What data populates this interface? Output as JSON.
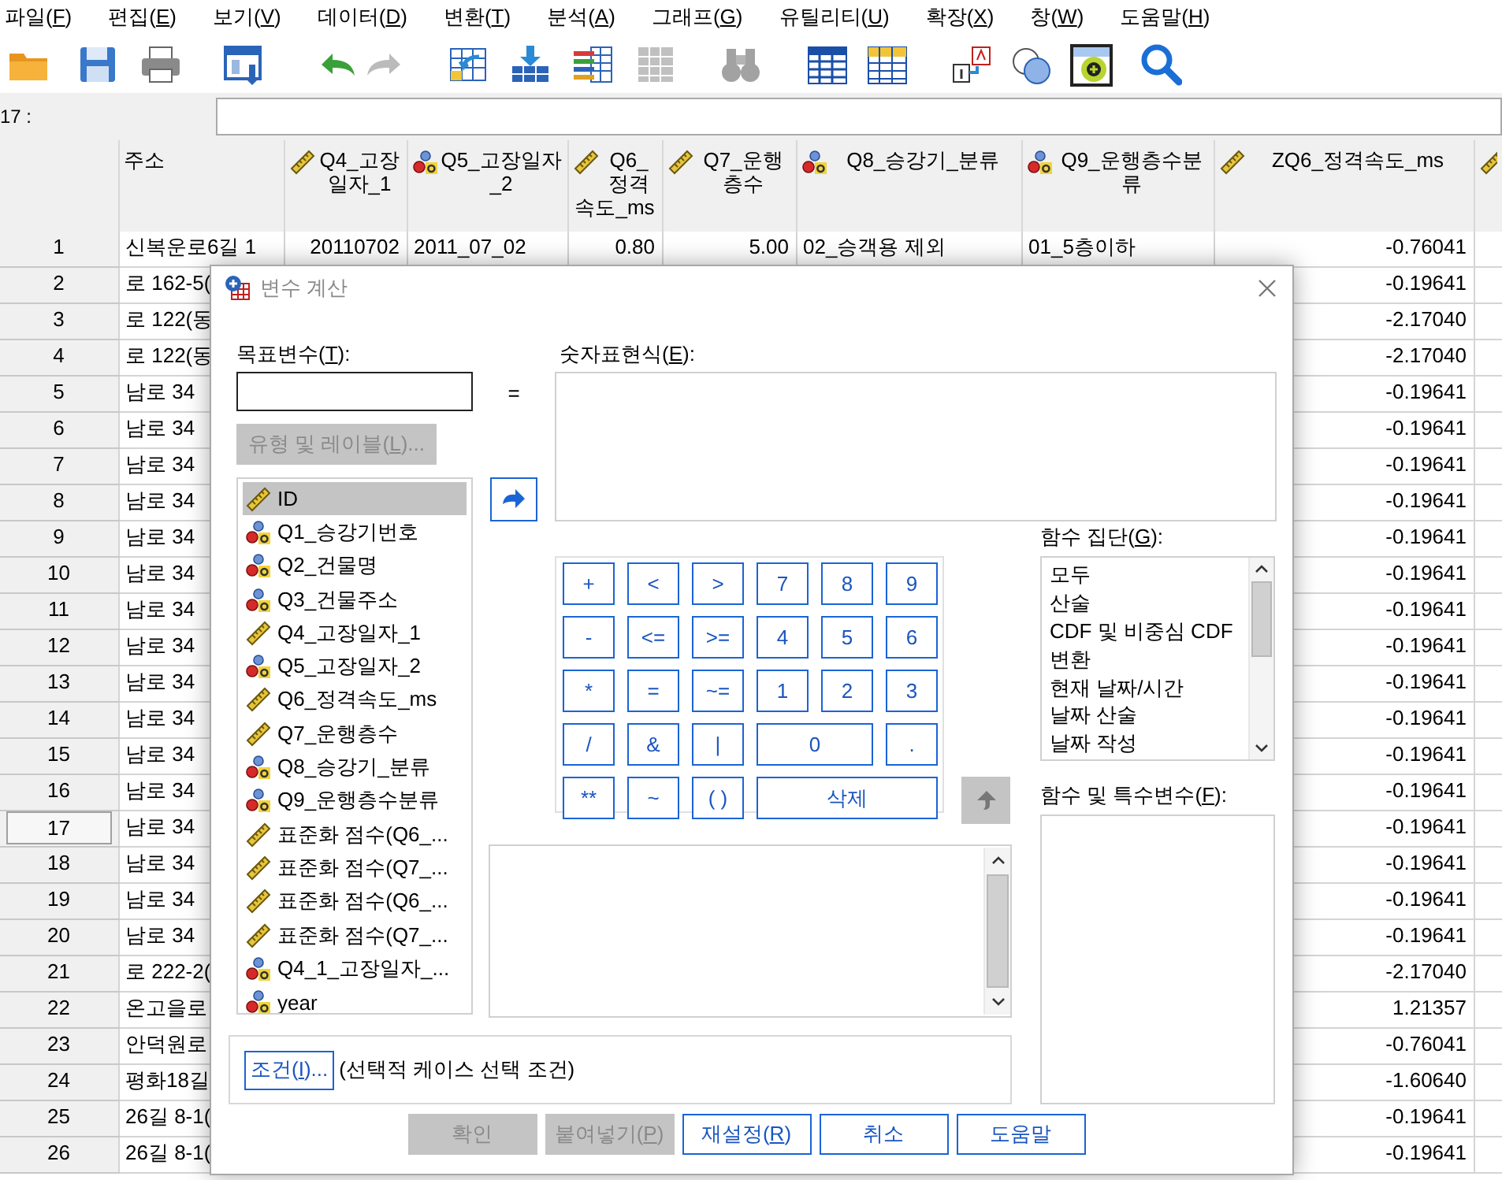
{
  "menu": [
    "파일(F)",
    "편집(E)",
    "보기(V)",
    "데이터(D)",
    "변환(T)",
    "분석(A)",
    "그래프(G)",
    "유틸리티(U)",
    "확장(X)",
    "창(W)",
    "도움말(H)"
  ],
  "toolbar": [
    {
      "disabled": false
    },
    {
      "disabled": false
    },
    {
      "disabled": false
    },
    {
      "disabled": false
    },
    {
      "disabled": false
    },
    {
      "disabled": true
    },
    {
      "disabled": false
    },
    {
      "disabled": false
    },
    {
      "disabled": false
    },
    {
      "disabled": true
    },
    {
      "disabled": true
    },
    {
      "disabled": false
    },
    {
      "disabled": false
    },
    {
      "disabled": false
    },
    {
      "disabled": false
    },
    {
      "disabled": false
    },
    {
      "disabled": false
    }
  ],
  "cell_ref": {
    "label": "17 :"
  },
  "grid": {
    "columns": [
      {
        "label": "주소"
      },
      {
        "label": "Q4_고장일자_1",
        "kind": "scale"
      },
      {
        "label": "Q5_고장일자_2",
        "kind": "nominal"
      },
      {
        "label": "Q6_정격속도_ms",
        "kind": "scale"
      },
      {
        "label": "Q7_운행층수",
        "kind": "scale"
      },
      {
        "label": "Q8_승강기_분류",
        "kind": "nominal"
      },
      {
        "label": "Q9_운행층수분류",
        "kind": "nominal"
      },
      {
        "label": "ZQ6_정격속도_ms",
        "kind": "scale"
      },
      {
        "kind": "scale"
      }
    ],
    "rows": [
      {
        "number": "1",
        "selected": false,
        "cells": [
          "신복운로6길 1",
          "20110702",
          "2011_07_02",
          "0.80",
          "5.00",
          "02_승객용 제외",
          "01_5층이하",
          "-0.76041"
        ]
      },
      {
        "number": "2",
        "selected": false,
        "cells": [
          "로 162-5(",
          null,
          null,
          null,
          null,
          null,
          null,
          "-0.19641"
        ]
      },
      {
        "number": "3",
        "selected": false,
        "cells": [
          "로 122(동",
          null,
          null,
          null,
          null,
          null,
          null,
          "-2.17040"
        ]
      },
      {
        "number": "4",
        "selected": false,
        "cells": [
          "로 122(동",
          null,
          null,
          null,
          null,
          null,
          null,
          "-2.17040"
        ]
      },
      {
        "number": "5",
        "selected": false,
        "cells": [
          "남로 34",
          null,
          null,
          null,
          null,
          null,
          null,
          "-0.19641"
        ]
      },
      {
        "number": "6",
        "selected": false,
        "cells": [
          "남로 34",
          null,
          null,
          null,
          null,
          null,
          null,
          "-0.19641"
        ]
      },
      {
        "number": "7",
        "selected": false,
        "cells": [
          "남로 34",
          null,
          null,
          null,
          null,
          null,
          null,
          "-0.19641"
        ]
      },
      {
        "number": "8",
        "selected": false,
        "cells": [
          "남로 34",
          null,
          null,
          null,
          null,
          null,
          null,
          "-0.19641"
        ]
      },
      {
        "number": "9",
        "selected": false,
        "cells": [
          "남로 34",
          null,
          null,
          null,
          null,
          null,
          null,
          "-0.19641"
        ]
      },
      {
        "number": "10",
        "selected": false,
        "cells": [
          "남로 34",
          null,
          null,
          null,
          null,
          null,
          null,
          "-0.19641"
        ]
      },
      {
        "number": "11",
        "selected": false,
        "cells": [
          "남로 34",
          null,
          null,
          null,
          null,
          null,
          null,
          "-0.19641"
        ]
      },
      {
        "number": "12",
        "selected": false,
        "cells": [
          "남로 34",
          null,
          null,
          null,
          null,
          null,
          null,
          "-0.19641"
        ]
      },
      {
        "number": "13",
        "selected": false,
        "cells": [
          "남로 34",
          null,
          null,
          null,
          null,
          null,
          null,
          "-0.19641"
        ]
      },
      {
        "number": "14",
        "selected": false,
        "cells": [
          "남로 34",
          null,
          null,
          null,
          null,
          null,
          null,
          "-0.19641"
        ]
      },
      {
        "number": "15",
        "selected": false,
        "cells": [
          "남로 34",
          null,
          null,
          null,
          null,
          null,
          null,
          "-0.19641"
        ]
      },
      {
        "number": "16",
        "selected": false,
        "cells": [
          "남로 34",
          null,
          null,
          null,
          null,
          null,
          null,
          "-0.19641"
        ]
      },
      {
        "number": "17",
        "selected": true,
        "cells": [
          "남로 34",
          null,
          null,
          null,
          null,
          null,
          null,
          "-0.19641"
        ]
      },
      {
        "number": "18",
        "selected": false,
        "cells": [
          "남로 34",
          null,
          null,
          null,
          null,
          null,
          null,
          "-0.19641"
        ]
      },
      {
        "number": "19",
        "selected": false,
        "cells": [
          "남로 34",
          null,
          null,
          null,
          null,
          null,
          null,
          "-0.19641"
        ]
      },
      {
        "number": "20",
        "selected": false,
        "cells": [
          "남로 34",
          null,
          null,
          null,
          null,
          null,
          null,
          "-0.19641"
        ]
      },
      {
        "number": "21",
        "selected": false,
        "cells": [
          "로 222-2(",
          null,
          null,
          null,
          null,
          null,
          null,
          "-2.17040"
        ]
      },
      {
        "number": "22",
        "selected": false,
        "cells": [
          "온고을로",
          null,
          null,
          null,
          null,
          null,
          null,
          "1.21357"
        ]
      },
      {
        "number": "23",
        "selected": false,
        "cells": [
          "안덕원로",
          null,
          null,
          null,
          null,
          null,
          null,
          "-0.76041"
        ]
      },
      {
        "number": "24",
        "selected": false,
        "cells": [
          "평화18길",
          null,
          null,
          null,
          null,
          null,
          null,
          "-1.60640"
        ]
      },
      {
        "number": "25",
        "selected": false,
        "cells": [
          "26길 8-1(",
          null,
          null,
          null,
          null,
          null,
          null,
          "-0.19641"
        ]
      },
      {
        "number": "26",
        "selected": false,
        "cells": [
          "26길 8-1(",
          null,
          null,
          null,
          null,
          null,
          null,
          "-0.19641"
        ]
      }
    ]
  },
  "dialog": {
    "title": "변수 계산",
    "target_label": "목표변수(T):",
    "expression_label": "숫자표현식(E):",
    "type_button": {
      "label": "유형 및 레이블(L)...",
      "disabled": true
    },
    "variables": [
      {
        "label": "ID",
        "kind": "scale",
        "selected": true
      },
      {
        "label": "Q1_승강기번호",
        "kind": "nominal",
        "selected": false
      },
      {
        "label": "Q2_건물명",
        "kind": "nominal",
        "selected": false
      },
      {
        "label": "Q3_건물주소",
        "kind": "nominal",
        "selected": false
      },
      {
        "label": "Q4_고장일자_1",
        "kind": "scale",
        "selected": false
      },
      {
        "label": "Q5_고장일자_2",
        "kind": "nominal",
        "selected": false
      },
      {
        "label": "Q6_정격속도_ms",
        "kind": "scale",
        "selected": false
      },
      {
        "label": "Q7_운행층수",
        "kind": "scale",
        "selected": false
      },
      {
        "label": "Q8_승강기_분류",
        "kind": "nominal",
        "selected": false
      },
      {
        "label": "Q9_운행층수분류",
        "kind": "nominal",
        "selected": false
      },
      {
        "label": "표준화 점수(Q6_...",
        "kind": "scale",
        "selected": false
      },
      {
        "label": "표준화 점수(Q7_...",
        "kind": "scale",
        "selected": false
      },
      {
        "label": "표준화 점수(Q6_...",
        "kind": "scale",
        "selected": false
      },
      {
        "label": "표준화 점수(Q7_...",
        "kind": "scale",
        "selected": false
      },
      {
        "label": "Q4_1_고장일자_...",
        "kind": "nominal",
        "selected": false
      },
      {
        "label": "year",
        "kind": "nominal",
        "selected": false
      }
    ],
    "equals": "=",
    "move_button": {
      "disabled": false
    },
    "keypad": [
      {
        "label": "+",
        "kind": "key"
      },
      {
        "label": "<",
        "kind": "key"
      },
      {
        "label": ">",
        "kind": "key"
      },
      {
        "label": "7",
        "kind": "key"
      },
      {
        "label": "8",
        "kind": "key"
      },
      {
        "label": "9",
        "kind": "key"
      },
      {
        "label": "-",
        "kind": "key"
      },
      {
        "label": "<=",
        "kind": "key"
      },
      {
        "label": ">=",
        "kind": "key"
      },
      {
        "label": "4",
        "kind": "key"
      },
      {
        "label": "5",
        "kind": "key"
      },
      {
        "label": "6",
        "kind": "key"
      },
      {
        "label": "*",
        "kind": "key"
      },
      {
        "label": "=",
        "kind": "key"
      },
      {
        "label": "~=",
        "kind": "key"
      },
      {
        "label": "1",
        "kind": "key"
      },
      {
        "label": "2",
        "kind": "key"
      },
      {
        "label": "3",
        "kind": "key"
      },
      {
        "label": "/",
        "kind": "key"
      },
      {
        "label": "&",
        "kind": "key"
      },
      {
        "label": "|",
        "kind": "key"
      },
      {
        "label": "0",
        "kind": "wide"
      },
      {
        "label": ".",
        "kind": "key"
      },
      {
        "label": "**",
        "kind": "key"
      },
      {
        "label": "~",
        "kind": "key"
      },
      {
        "label": "( )",
        "kind": "key"
      },
      {
        "label": "삭제",
        "kind": "delete"
      }
    ],
    "up_button": {
      "disabled": true
    },
    "group_label": "함수 집단(G):",
    "groups": [
      "모두",
      "산술",
      "CDF 및 비중심 CDF",
      "변환",
      "현재 날짜/시간",
      "날짜 산술",
      "날짜 작성"
    ],
    "functions_label": "함수 및 특수변수(F):",
    "condition_button": "조건(I)...",
    "condition_text": "(선택적 케이스 선택 조건)",
    "buttons": [
      {
        "label": "확인",
        "disabled": true
      },
      {
        "label": "붙여넣기(P)",
        "disabled": true
      },
      {
        "label": "재설정(R)",
        "disabled": false
      },
      {
        "label": "취소",
        "disabled": false
      },
      {
        "label": "도움말",
        "disabled": false
      }
    ]
  }
}
